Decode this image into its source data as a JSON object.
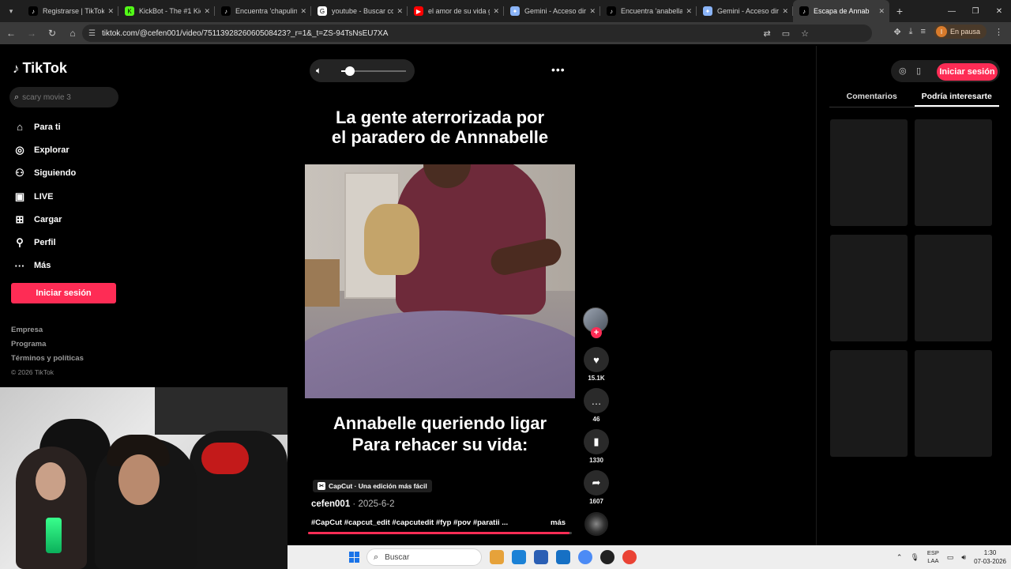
{
  "browser": {
    "tabs": [
      {
        "title": "Registrarse | TikTok",
        "fav": "♪",
        "fav_color": "#000000"
      },
      {
        "title": "KickBot - The #1 Kick",
        "fav": "K",
        "fav_color": "#53fc18"
      },
      {
        "title": "Encuentra 'chapulin'",
        "fav": "♪",
        "fav_color": "#000000"
      },
      {
        "title": "youtube - Buscar con",
        "fav": "G",
        "fav_color": "#ffffff"
      },
      {
        "title": "el amor de su vida g",
        "fav": "▶",
        "fav_color": "#ff0000"
      },
      {
        "title": "Gemini - Acceso dire",
        "fav": "✦",
        "fav_color": "#8ab4f8"
      },
      {
        "title": "Encuentra 'anabella",
        "fav": "♪",
        "fav_color": "#000000"
      },
      {
        "title": "Gemini - Acceso dire",
        "fav": "✦",
        "fav_color": "#8ab4f8"
      },
      {
        "title": "Escapa de Annab",
        "fav": "♪",
        "fav_color": "#000000"
      }
    ],
    "url": "tiktok.com/@cefen001/video/7511392826060508423?_r=1&_t=ZS-94TsNsEU7XA",
    "profile_status": "En pausa",
    "profile_initial": "I"
  },
  "sidebar": {
    "logo": "TikTok",
    "search_placeholder": "scary movie 3",
    "items": [
      {
        "label": "Para ti",
        "icon": "⌂"
      },
      {
        "label": "Explorar",
        "icon": "◎"
      },
      {
        "label": "Siguiendo",
        "icon": "⚇"
      },
      {
        "label": "LIVE",
        "icon": "▣"
      },
      {
        "label": "Cargar",
        "icon": "⊞"
      },
      {
        "label": "Perfil",
        "icon": "⚲"
      },
      {
        "label": "Más",
        "icon": "···"
      }
    ],
    "login_label": "Iniciar sesión",
    "footer": {
      "company": "Empresa",
      "program": "Programa",
      "terms": "Términos y políticas",
      "copyright": "© 2026 TikTok"
    }
  },
  "player": {
    "volume": 0.14,
    "caption_top_line1": "La gente aterrorizada por",
    "caption_top_line2": "el paradero de Annnabelle",
    "caption_bottom_line1": "Annabelle queriendo ligar",
    "caption_bottom_line2": "Para rehacer su vida:",
    "capcut_label": "CapCut · Una edición más fácil",
    "author": "cefen001",
    "date": " · 2025-6-2",
    "hashtags": "#CapCut #capcut_edit #capcutedit #fyp #pov #paratii ...",
    "more_label": "más",
    "progress": 0.99
  },
  "actions": {
    "likes": "15.1K",
    "comments": "46",
    "saves": "1330",
    "shares": "1607"
  },
  "right_panel": {
    "login_label": "Iniciar sesión",
    "tabs": [
      "Comentarios",
      "Podría interesarte"
    ],
    "active_tab": "Podría interesarte"
  },
  "taskbar": {
    "search_placeholder": "Buscar",
    "language_line1": "ESP",
    "language_line2": "LAA",
    "time": "1:30",
    "date": "07-03-2026"
  },
  "colors": {
    "brand": "#fe2c55",
    "panel_bg": "#1a1a1a"
  }
}
